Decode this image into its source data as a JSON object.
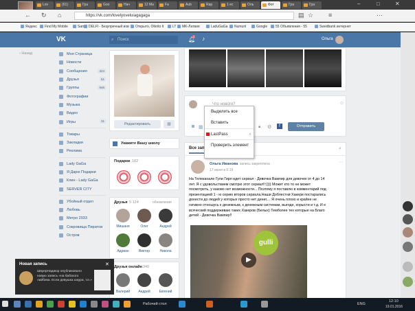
{
  "browser": {
    "tabs": [
      "Lov",
      "(61)",
      "Гра",
      "Goo",
      "Нач",
      "12 Ма",
      "Fa",
      "Aub",
      "Rap",
      "1 ес",
      "Оль",
      "Фот",
      "Гра",
      "Гра"
    ],
    "url": "https://vk.com/lovelyoveluiagagaga",
    "bookmarks": [
      "Яндекс",
      "Find My Mobile",
      "Sam",
      "DELFI - Безупречный иов",
      "Открыто, Otkrito lt",
      "LT",
      "MK-Латвия",
      "LaduGaGa",
      "Numunl",
      "Google",
      "55 Объявления - 55",
      "Swedbank интернет"
    ]
  },
  "vk": {
    "logo": "VK",
    "search_placeholder": "Поиск",
    "notifications": "2",
    "user_name": "Ольга",
    "back_label": "Назад",
    "nav": [
      {
        "label": "Моя Страница",
        "badge": ""
      },
      {
        "label": "Новости",
        "badge": ""
      },
      {
        "label": "Сообщения",
        "badge": "324"
      },
      {
        "label": "Друзья",
        "badge": "51"
      },
      {
        "label": "Группы",
        "badge": "946"
      },
      {
        "label": "Фотографии",
        "badge": ""
      },
      {
        "label": "Музыка",
        "badge": ""
      },
      {
        "label": "Видео",
        "badge": ""
      },
      {
        "label": "Игры",
        "badge": "31"
      }
    ],
    "nav2": [
      "Товары",
      "Закладки",
      "Реклама"
    ],
    "nav3": [
      "Lady GaGa",
      "Я Дарю Подарки",
      "Клин - Lady GaGa",
      "SERVER CITY"
    ],
    "nav4": [
      "Убойный отдел",
      "Любовь",
      "Метро 2033",
      "Сокровища Пиратов",
      "Остров"
    ],
    "edit_button": "Редактировать",
    "school_prompt": "Укажите Вашу школу",
    "gifts_title": "Подарки",
    "gifts_count": "182",
    "friends_title": "Друзья",
    "friends_count": "5 124",
    "friends_updates": "обновления",
    "friends": [
      "Мишаня",
      "Олег",
      "Андрей",
      "Адриан",
      "Виктор",
      "Никола"
    ],
    "friends_online_title": "Друзья онлайн",
    "friends_online_count": "340",
    "friends_online": [
      "Валерий",
      "Андрей",
      "Евгений"
    ],
    "composer_placeholder": "Что нового?",
    "send_button": "Отправить",
    "wall_tab": "Все записи",
    "post": {
      "author": "Ольга Иванова",
      "pinned": "запись закреплена",
      "date": "17 июня в 6:19",
      "text": [
        "На Телеканале Гули Гирл идет сериал - Девочка Вампир для девочек от 4 до 14",
        "лет. Я с удовольствием смотрю этот сериал!!:)))) Может кто то не может",
        "посмотреть, у каково нет возможности... Поэтому я поставлю в комментарий под",
        "презентацией 1 - ю серию второв сериала.Наши Доблестни Хакери постарались",
        "донести до людей у которых просто нет денег.... Я очень плохо и крайне не",
        "гативно отношусь к денежным, к денежным системам, выгоде, корысти и т.д. И е",
        "всяческий поддерживаю таких Хакеров (Белых) Темболее тех которые на Благо",
        "детей - Девочка Вампир!!"
      ]
    }
  },
  "context_menu": [
    "Выделить все",
    "Вставить",
    "LastPass",
    "Проверить элемент"
  ],
  "toast": {
    "title": "Новая запись",
    "text": "ШвуерНадиюр опубликовало новую запись «на бабского лайбика. Если девушка шкура, т.е.»"
  },
  "taskbar": {
    "desktop_label": "Рабочий стол",
    "lang": "ENG",
    "time": "12:10",
    "date": "19.01.2016"
  },
  "colors": {
    "vk_blue": "#4a76a8",
    "link": "#2a5885",
    "page_bg": "#edeef0"
  }
}
